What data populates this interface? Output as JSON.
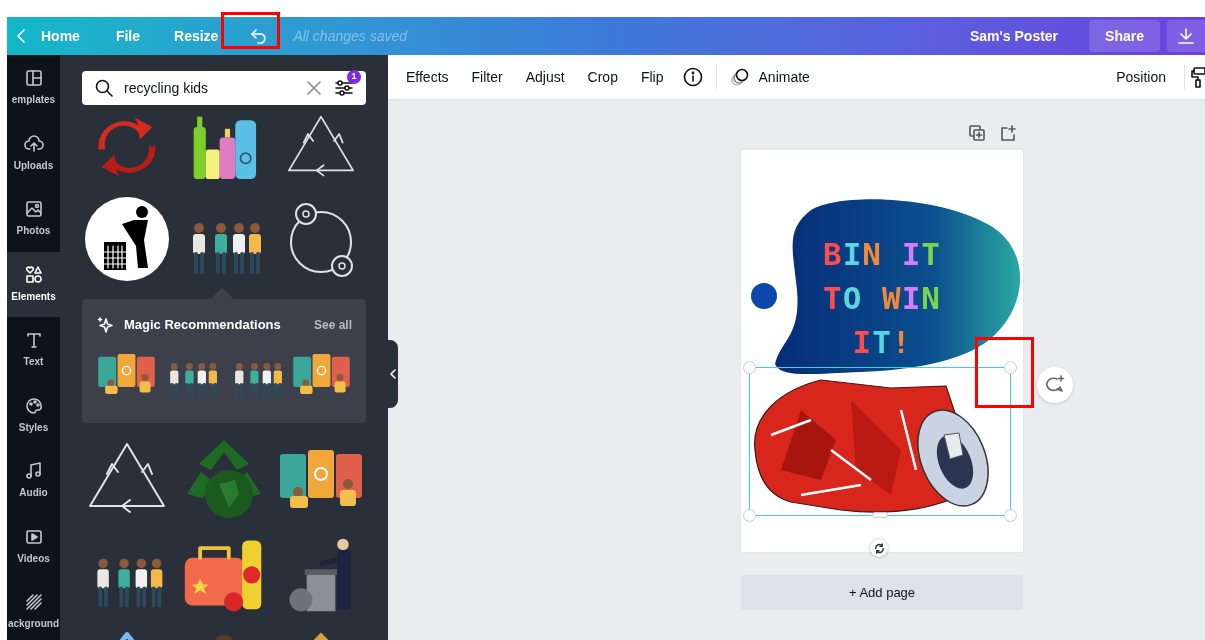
{
  "top_bar": {
    "back_label": "Home",
    "menu": [
      "File",
      "Resize"
    ],
    "save_status": "All changes saved",
    "document_title": "Sam's Poster",
    "share_button": "Share"
  },
  "sidebar": {
    "items": [
      {
        "label": "emplates",
        "selected": false
      },
      {
        "label": "Uploads",
        "selected": false
      },
      {
        "label": "Photos",
        "selected": false
      },
      {
        "label": "Elements",
        "selected": true
      },
      {
        "label": "Text",
        "selected": false
      },
      {
        "label": "Styles",
        "selected": false
      },
      {
        "label": "Audio",
        "selected": false
      },
      {
        "label": "Videos",
        "selected": false
      },
      {
        "label": "ackground",
        "selected": false
      }
    ]
  },
  "search": {
    "value": "recycling kids",
    "filter_badge": "1"
  },
  "recommendations": {
    "title": "Magic Recommendations",
    "see_all": "See all"
  },
  "toolbar": {
    "items": [
      "Effects",
      "Filter",
      "Adjust",
      "Crop",
      "Flip"
    ],
    "animate": "Animate",
    "position": "Position"
  },
  "poster": {
    "headline": [
      {
        "text": "BIN IT",
        "letters": [
          {
            "color": "#ff4d4d"
          },
          {
            "color": "#5ad6e0"
          },
          {
            "color": "#f08a3a"
          },
          {
            "color": "#d77cff"
          },
          {
            "color": "#7bd44d"
          }
        ]
      },
      {
        "text": "TO WIN",
        "letters": [
          {
            "color": "#ff4d4d"
          },
          {
            "color": "#5ad6e0"
          },
          {
            "color": "#f08a3a"
          },
          {
            "color": "#d77cff"
          },
          {
            "color": "#7bd44d"
          }
        ]
      },
      {
        "text": "IT!",
        "letters": [
          {
            "color": "#ff4d4d"
          },
          {
            "color": "#5ad6e0"
          },
          {
            "color": "#f08a3a"
          }
        ]
      }
    ]
  },
  "add_page": "+ Add page"
}
